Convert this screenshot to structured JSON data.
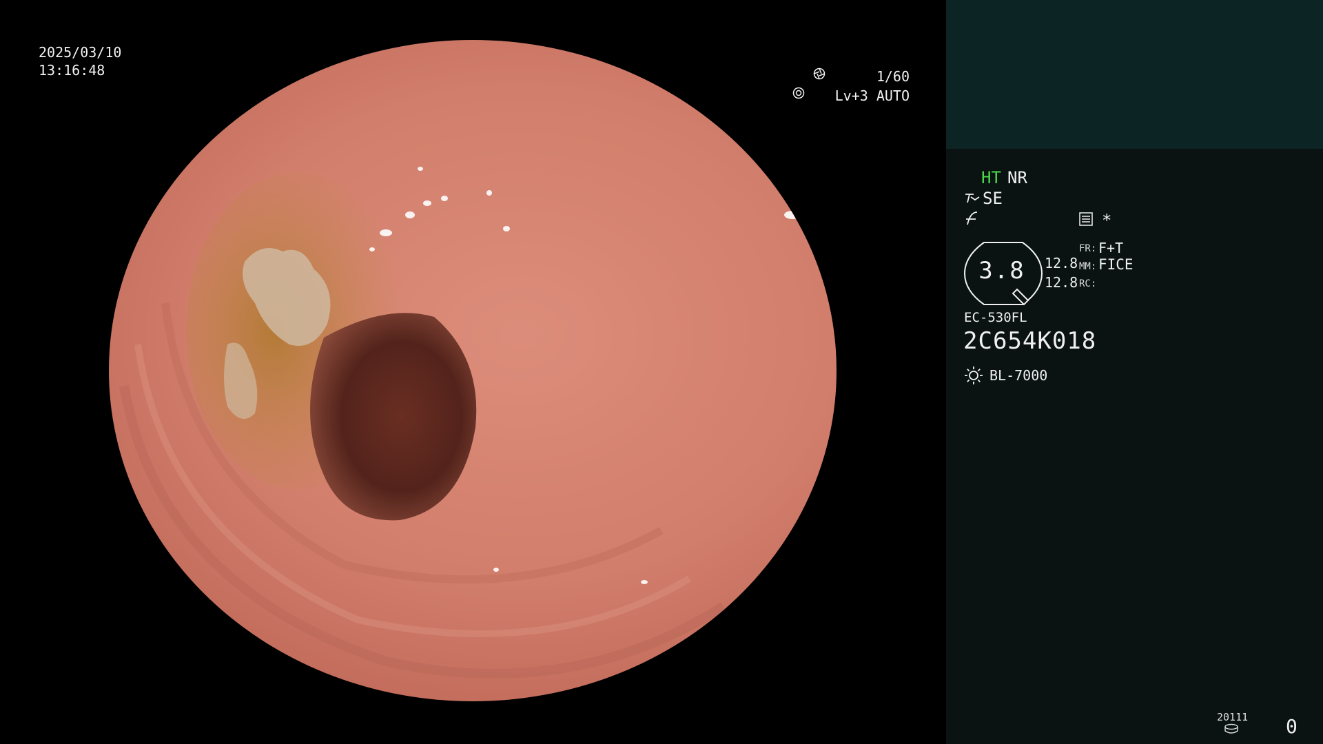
{
  "video": {
    "date": "2025/03/10",
    "time": "13:16:48",
    "shutter": "1/60",
    "shutter_icon": "shutter-icon",
    "level": "Lv+3 AUTO",
    "level_icon": "iris-icon"
  },
  "panel": {
    "ht": "HT",
    "nr": "NR",
    "se": "SE",
    "star": "*",
    "lens_value": "3.8",
    "value_1": "12.8",
    "value_2": "12.8",
    "fr_label": "FR:",
    "fr_value": "F+T",
    "mm_label": "MM:",
    "mm_value": "FICE",
    "rc_label": "RC:",
    "scope_model": "EC-530FL",
    "scope_serial": "2C654K018",
    "light_source": "BL-7000",
    "counter": "20111",
    "count": "0"
  },
  "colors": {
    "ht_green": "#4cd94c",
    "panel_bg": "#0a1212",
    "panel_top_bg": "#0d2424"
  }
}
